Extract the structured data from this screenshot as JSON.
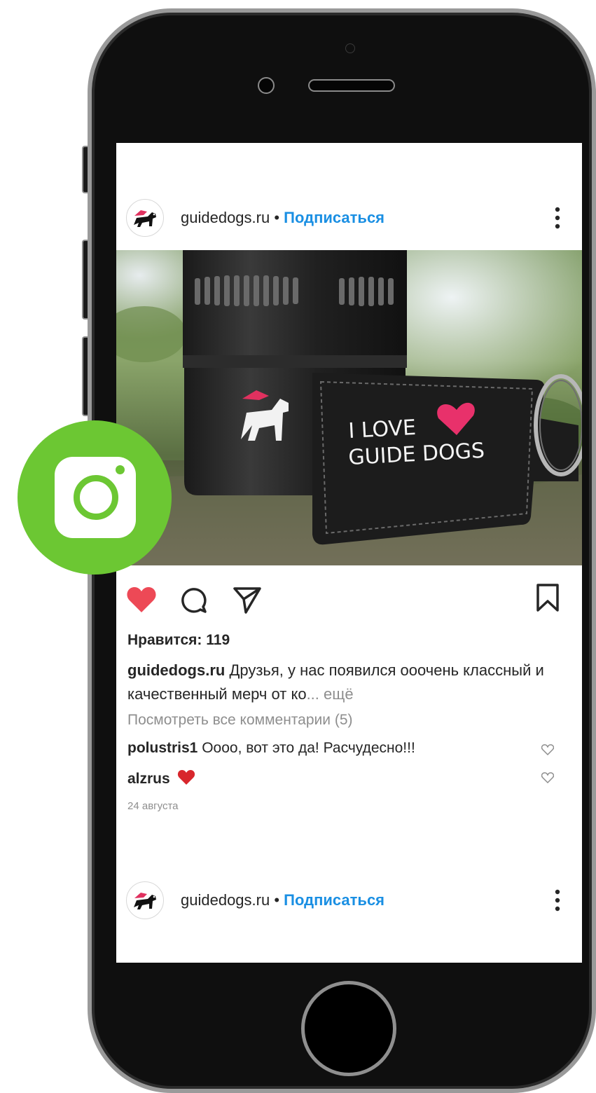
{
  "posts": [
    {
      "username": "guidedogs.ru",
      "separator": "•",
      "follow_label": "Подписаться"
    },
    {
      "username": "guidedogs.ru",
      "separator": "•",
      "follow_label": "Подписаться"
    }
  ],
  "photo": {
    "tag_line1": "I LOVE",
    "tag_line2": "GUIDE DOGS"
  },
  "actions": {
    "like_icon": "heart-filled-icon",
    "comment_icon": "comment-icon",
    "share_icon": "paper-plane-icon",
    "save_icon": "bookmark-icon",
    "like_color": "#ed4956"
  },
  "likes_text": "Нравится: 119",
  "caption": {
    "author": "guidedogs.ru",
    "text": " Друзья, у нас появился ооочень классный и качественный мерч от ко",
    "ellipsis": "...",
    "more": " ещё"
  },
  "view_comments": "Посмотреть все комментарии (5)",
  "comments": [
    {
      "author": "polustris1",
      "text": " Оооо, вот это да! Расчудесно!!!"
    },
    {
      "author": "alzrus",
      "text": ""
    }
  ],
  "date": "24 августа",
  "badge": {
    "icon": "instagram-icon",
    "color": "#6cc733"
  },
  "colors": {
    "link": "#1a8fe3",
    "muted": "#8e8e8e",
    "text": "#262626"
  }
}
